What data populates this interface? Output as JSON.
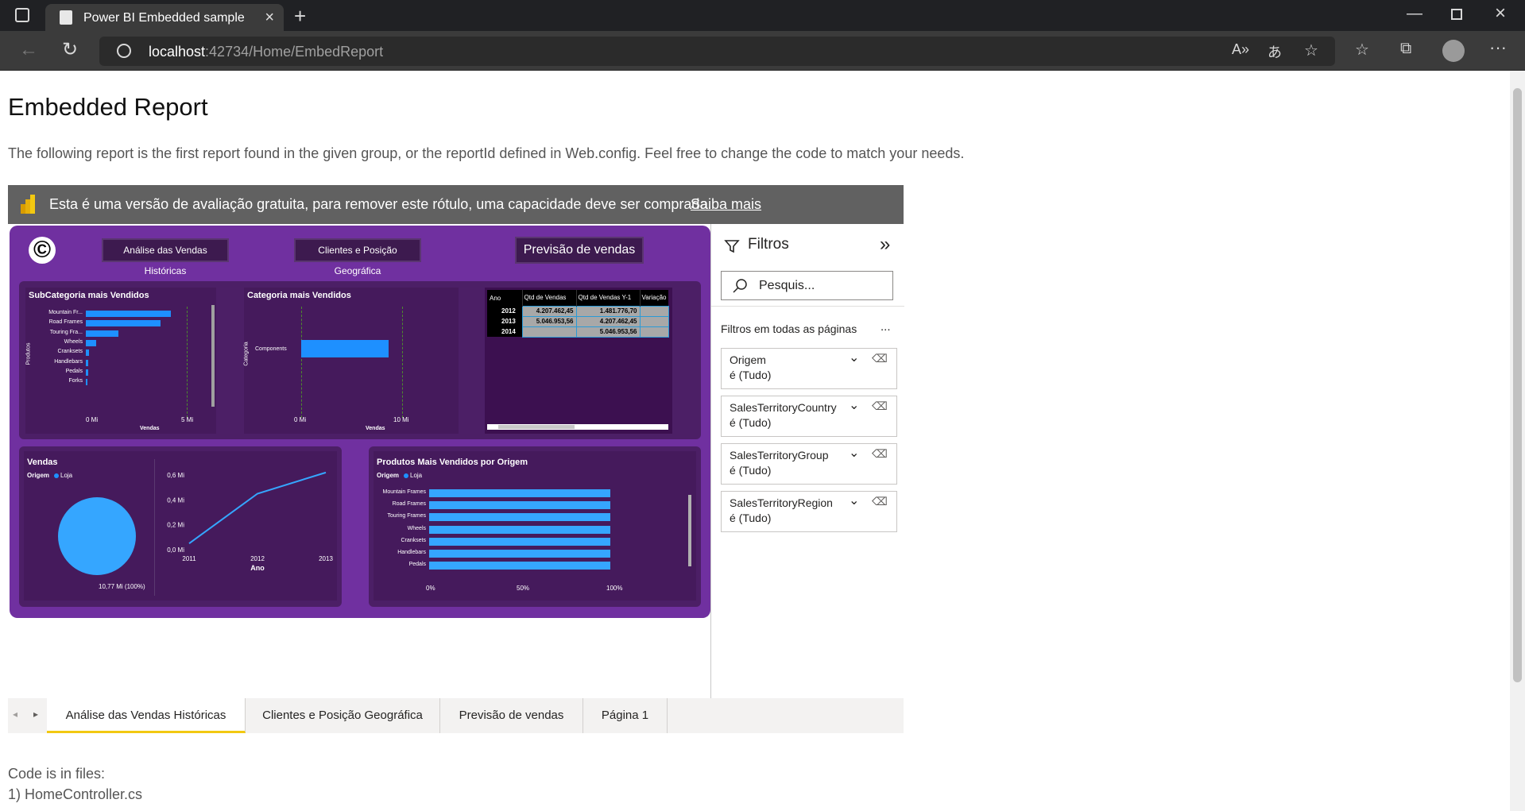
{
  "browser": {
    "tab_title": "Power BI Embedded sample",
    "url_host": "localhost",
    "url_path": ":42734/Home/EmbedReport"
  },
  "page": {
    "title": "Embedded Report",
    "description": "The following report is the first report found in the given group, or the reportId defined in Web.config. Feel free to change the code to match your needs.",
    "code_label": "Code is in files:",
    "code_file": "1) HomeController.cs"
  },
  "trial_banner": {
    "text": "Esta é uma versão de avaliação gratuita, para remover este rótulo, uma capacidade deve ser comprada.",
    "link": "Saiba mais"
  },
  "report": {
    "logo": "©",
    "nav_buttons": [
      "Análise das Vendas Históricas",
      "Clientes e Posição Geográfica",
      "Previsão de vendas"
    ],
    "subcat_chart": {
      "title": "SubCategoria mais Vendidos",
      "ylabel": "Produtos",
      "xlabel": "Vendas",
      "x_ticks": [
        "0 Mi",
        "5 Mi"
      ],
      "categories": [
        "Mountain Fr...",
        "Road Frames",
        "Touring Fra...",
        "Wheels",
        "Cranksets",
        "Handlebars",
        "Pedals",
        "Forks"
      ],
      "values": [
        4.2,
        3.7,
        1.6,
        0.5,
        0.15,
        0.12,
        0.1,
        0.05
      ],
      "xlim": [
        0,
        5
      ]
    },
    "cat_chart": {
      "title": "Categoria mais Vendidos",
      "ylabel": "Categoria",
      "xlabel": "Vendas",
      "x_ticks": [
        "0 Mi",
        "10 Mi"
      ],
      "categories": [
        "Components"
      ],
      "values": [
        10.77
      ],
      "xlim": [
        0,
        10.77
      ]
    },
    "table": {
      "headers": [
        "Ano",
        "Qtd de Vendas",
        "Qtd de Vendas Y-1",
        "Variação"
      ],
      "rows": [
        [
          "2012",
          "4.207.462,45",
          "1.481.776,70",
          ""
        ],
        [
          "2013",
          "5.046.953,56",
          "4.207.462,45",
          ""
        ],
        [
          "2014",
          "",
          "5.046.953,56",
          ""
        ]
      ]
    },
    "vendas_chart": {
      "title": "Vendas",
      "legend_title": "Origem",
      "legend_item": "Loja",
      "pie_label": "10,77 Mi (100%)",
      "line_x": [
        "2011",
        "2012",
        "2013"
      ],
      "line_y": [
        0.05,
        0.45,
        0.62
      ],
      "y_ticks": [
        "0,6 Mi",
        "0,4 Mi",
        "0,2 Mi",
        "0,0 Mi"
      ],
      "ylim": [
        0,
        0.6
      ],
      "xlabel": "Ano"
    },
    "produtos_chart": {
      "title": "Produtos Mais Vendidos por Origem",
      "legend_title": "Origem",
      "legend_item": "Loja",
      "categories": [
        "Mountain Frames",
        "Road Frames",
        "Touring Frames",
        "Wheels",
        "Cranksets",
        "Handlebars",
        "Pedals"
      ],
      "values": [
        100,
        100,
        100,
        100,
        100,
        100,
        100
      ],
      "x_ticks": [
        "0%",
        "50%",
        "100%"
      ]
    }
  },
  "filters": {
    "title": "Filtros",
    "search_placeholder": "Pesquis...",
    "section_title": "Filtros em todas as páginas",
    "more": "...",
    "cards": [
      {
        "name": "Origem",
        "value": "é (Tudo)"
      },
      {
        "name": "SalesTerritoryCountry",
        "value": "é (Tudo)"
      },
      {
        "name": "SalesTerritoryGroup",
        "value": "é (Tudo)"
      },
      {
        "name": "SalesTerritoryRegion",
        "value": "é (Tudo)"
      }
    ]
  },
  "page_tabs": [
    "Análise das Vendas Históricas",
    "Clientes e Posição Geográfica",
    "Previsão de vendas",
    "Página 1"
  ],
  "colors": {
    "report_bg": "#7030a0",
    "bar": "#1e90ff",
    "tab_active_underline": "#f2c811"
  }
}
